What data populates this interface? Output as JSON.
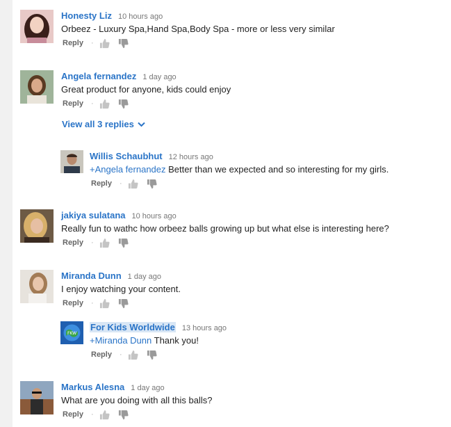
{
  "common": {
    "reply_label": "Reply",
    "separator": "·"
  },
  "comments": [
    {
      "author": "Honesty Liz",
      "time": "10 hours ago",
      "text": "Orbeez - Luxury Spa,Hand Spa,Body Spa - more or less very similar"
    },
    {
      "author": "Angela fernandez",
      "time": "1 day ago",
      "text": "Great product for anyone, kids could enjoy",
      "view_replies": "View all 3 replies",
      "replies": [
        {
          "author": "Willis Schaubhut",
          "time": "12 hours ago",
          "mention": "+Angela fernandez",
          "text": " Better than we expected  and so interesting for my girls."
        }
      ]
    },
    {
      "author": "jakiya sulatana",
      "time": "10 hours ago",
      "text": "Really fun to wathc how orbeez balls growing up but what else is interesting here?"
    },
    {
      "author": "Miranda Dunn",
      "time": "1 day ago",
      "text": "I enjoy watching your content.",
      "replies": [
        {
          "author": "For Kids Worldwide",
          "time": "13 hours ago",
          "mention": "+Miranda Dunn",
          "text": " Thank you!"
        }
      ]
    },
    {
      "author": "Markus Alesna",
      "time": "1 day ago",
      "text": "What are you doing with all this balls?"
    }
  ]
}
